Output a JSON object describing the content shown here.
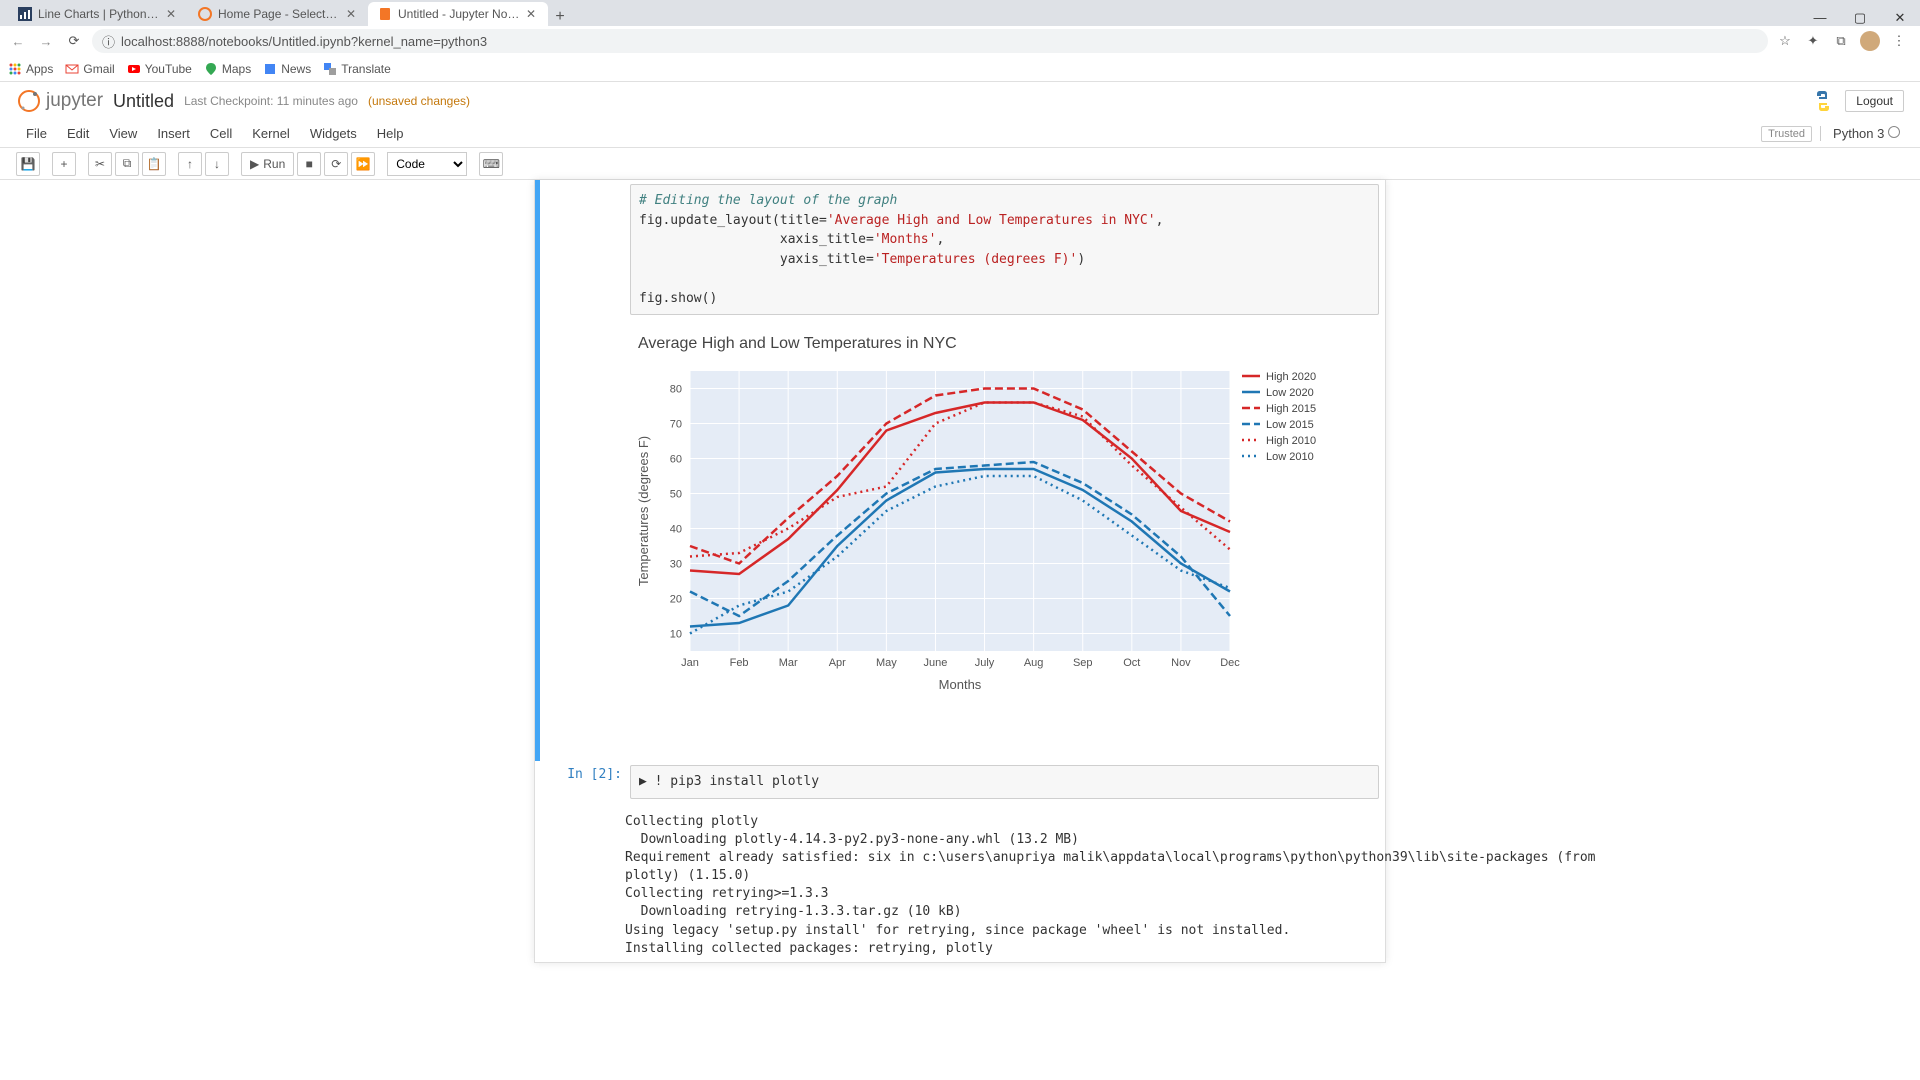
{
  "browser": {
    "tabs": [
      {
        "title": "Line Charts | Python | Plotly"
      },
      {
        "title": "Home Page - Select or create a n"
      },
      {
        "title": "Untitled - Jupyter Notebook"
      }
    ],
    "url": "localhost:8888/notebooks/Untitled.ipynb?kernel_name=python3",
    "bookmarks": [
      "Apps",
      "Gmail",
      "YouTube",
      "Maps",
      "News",
      "Translate"
    ]
  },
  "jupyter": {
    "brand": "jupyter",
    "title": "Untitled",
    "checkpoint": "Last Checkpoint: 11 minutes ago",
    "unsaved": "(unsaved changes)",
    "logout": "Logout",
    "menu": [
      "File",
      "Edit",
      "View",
      "Insert",
      "Cell",
      "Kernel",
      "Widgets",
      "Help"
    ],
    "trusted": "Trusted",
    "kernel": "Python 3",
    "toolbar_run": "Run",
    "celltype": "Code"
  },
  "code_cell": {
    "comment": "# Editing the layout of the graph",
    "l1a": "fig.update_layout(title=",
    "l1b": "'Average High and Low Temperatures in NYC'",
    "l1c": ",",
    "l2a": "                  xaxis_title=",
    "l2b": "'Months'",
    "l2c": ",",
    "l3a": "                  yaxis_title=",
    "l3b": "'Temperatures (degrees F)'",
    "l3c": ")",
    "l4": "fig.show()"
  },
  "chart_data": {
    "type": "line",
    "title": "Average High and Low Temperatures in NYC",
    "xlabel": "Months",
    "ylabel": "Temperatures (degrees F)",
    "categories": [
      "Jan",
      "Feb",
      "Mar",
      "Apr",
      "May",
      "June",
      "July",
      "Aug",
      "Sep",
      "Oct",
      "Nov",
      "Dec"
    ],
    "ylim": [
      5,
      85
    ],
    "yticks": [
      10,
      20,
      30,
      40,
      50,
      60,
      70,
      80
    ],
    "series": [
      {
        "name": "High 2020",
        "color": "#d62728",
        "dash": "solid",
        "values": [
          28,
          27,
          37,
          51,
          68,
          73,
          76,
          76,
          71,
          60,
          45,
          39
        ]
      },
      {
        "name": "Low 2020",
        "color": "#1f77b4",
        "dash": "solid",
        "values": [
          12,
          13,
          18,
          35,
          48,
          56,
          57,
          57,
          51,
          42,
          30,
          22
        ]
      },
      {
        "name": "High 2015",
        "color": "#d62728",
        "dash": "dash",
        "values": [
          35,
          30,
          43,
          55,
          70,
          78,
          80,
          80,
          74,
          62,
          50,
          42
        ]
      },
      {
        "name": "Low 2015",
        "color": "#1f77b4",
        "dash": "dash",
        "values": [
          22,
          15,
          25,
          38,
          50,
          57,
          58,
          59,
          53,
          44,
          32,
          15
        ]
      },
      {
        "name": "High 2010",
        "color": "#d62728",
        "dash": "dot",
        "values": [
          32,
          33,
          40,
          49,
          52,
          70,
          76,
          76,
          72,
          58,
          46,
          34
        ]
      },
      {
        "name": "Low 2010",
        "color": "#1f77b4",
        "dash": "dot",
        "values": [
          10,
          18,
          22,
          32,
          45,
          52,
          55,
          55,
          48,
          38,
          28,
          23
        ]
      }
    ]
  },
  "cell2": {
    "prompt": "In [2]:",
    "code": "! pip3 install plotly",
    "output": "Collecting plotly\n  Downloading plotly-4.14.3-py2.py3-none-any.whl (13.2 MB)\nRequirement already satisfied: six in c:\\users\\anupriya malik\\appdata\\local\\programs\\python\\python39\\lib\\site-packages (from\nplotly) (1.15.0)\nCollecting retrying>=1.3.3\n  Downloading retrying-1.3.3.tar.gz (10 kB)\nUsing legacy 'setup.py install' for retrying, since package 'wheel' is not installed.\nInstalling collected packages: retrying, plotly"
  }
}
